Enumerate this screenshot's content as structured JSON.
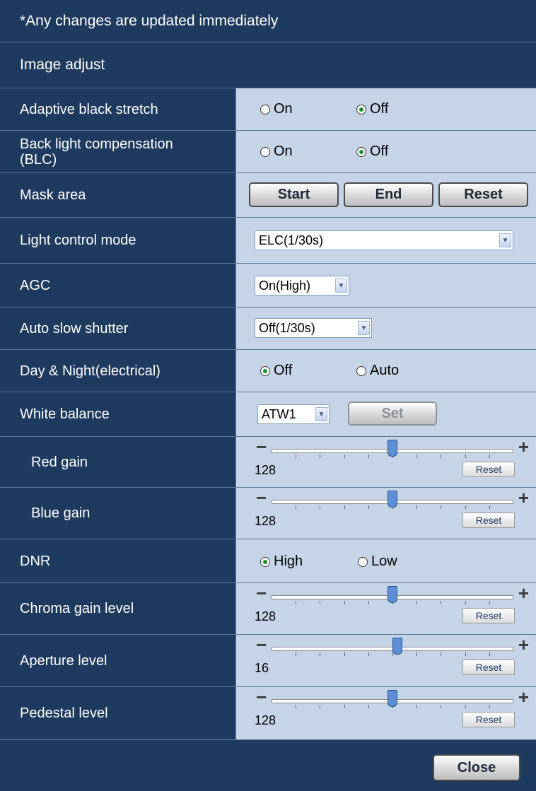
{
  "notice": "*Any changes are updated immediately",
  "section_title": "Image adjust",
  "adaptive_black_stretch": {
    "label": "Adaptive black stretch",
    "opt_on": "On",
    "opt_off": "Off",
    "selected": "Off"
  },
  "blc": {
    "label_line1": "Back light compensation",
    "label_line2": "(BLC)",
    "opt_on": "On",
    "opt_off": "Off",
    "selected": "Off"
  },
  "mask_area": {
    "label": "Mask area",
    "start": "Start",
    "end": "End",
    "reset": "Reset"
  },
  "light_control": {
    "label": "Light control mode",
    "value": "ELC(1/30s)"
  },
  "agc": {
    "label": "AGC",
    "value": "On(High)"
  },
  "auto_slow_shutter": {
    "label": "Auto slow shutter",
    "value": "Off(1/30s)"
  },
  "day_night": {
    "label": "Day & Night(electrical)",
    "opt_off": "Off",
    "opt_auto": "Auto",
    "selected": "Off"
  },
  "white_balance": {
    "label": "White balance",
    "value": "ATW1",
    "set": "Set"
  },
  "red_gain": {
    "label": "Red gain",
    "value": "128",
    "level": 0.5,
    "reset": "Reset"
  },
  "blue_gain": {
    "label": "Blue gain",
    "value": "128",
    "level": 0.5,
    "reset": "Reset"
  },
  "dnr": {
    "label": "DNR",
    "opt_high": "High",
    "opt_low": "Low",
    "selected": "High"
  },
  "chroma_gain": {
    "label": "Chroma gain level",
    "value": "128",
    "level": 0.5,
    "reset": "Reset"
  },
  "aperture": {
    "label": "Aperture level",
    "value": "16",
    "level": 0.52,
    "reset": "Reset"
  },
  "pedestal": {
    "label": "Pedestal level",
    "value": "128",
    "level": 0.5,
    "reset": "Reset"
  },
  "close": "Close",
  "colors": {
    "panel": "#1f3a5f",
    "control_bg": "#c6d4e8",
    "radio_dot": "#1a8f2a",
    "thumb": "#5d8fd6"
  },
  "icons": {
    "slider_minus": "minus-icon",
    "slider_plus": "plus-icon",
    "dropdown": "chevron-down-icon"
  }
}
